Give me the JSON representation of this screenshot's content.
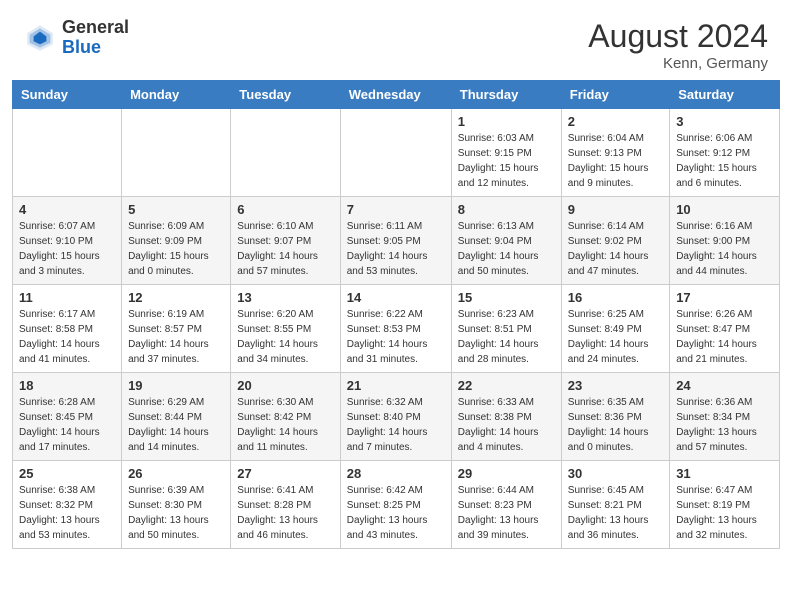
{
  "header": {
    "logo_general": "General",
    "logo_blue": "Blue",
    "month_year": "August 2024",
    "location": "Kenn, Germany"
  },
  "days_of_week": [
    "Sunday",
    "Monday",
    "Tuesday",
    "Wednesday",
    "Thursday",
    "Friday",
    "Saturday"
  ],
  "weeks": [
    [
      {
        "day": "",
        "sunrise": "",
        "sunset": "",
        "daylight": ""
      },
      {
        "day": "",
        "sunrise": "",
        "sunset": "",
        "daylight": ""
      },
      {
        "day": "",
        "sunrise": "",
        "sunset": "",
        "daylight": ""
      },
      {
        "day": "",
        "sunrise": "",
        "sunset": "",
        "daylight": ""
      },
      {
        "day": "1",
        "sunrise": "Sunrise: 6:03 AM",
        "sunset": "Sunset: 9:15 PM",
        "daylight": "Daylight: 15 hours and 12 minutes."
      },
      {
        "day": "2",
        "sunrise": "Sunrise: 6:04 AM",
        "sunset": "Sunset: 9:13 PM",
        "daylight": "Daylight: 15 hours and 9 minutes."
      },
      {
        "day": "3",
        "sunrise": "Sunrise: 6:06 AM",
        "sunset": "Sunset: 9:12 PM",
        "daylight": "Daylight: 15 hours and 6 minutes."
      }
    ],
    [
      {
        "day": "4",
        "sunrise": "Sunrise: 6:07 AM",
        "sunset": "Sunset: 9:10 PM",
        "daylight": "Daylight: 15 hours and 3 minutes."
      },
      {
        "day": "5",
        "sunrise": "Sunrise: 6:09 AM",
        "sunset": "Sunset: 9:09 PM",
        "daylight": "Daylight: 15 hours and 0 minutes."
      },
      {
        "day": "6",
        "sunrise": "Sunrise: 6:10 AM",
        "sunset": "Sunset: 9:07 PM",
        "daylight": "Daylight: 14 hours and 57 minutes."
      },
      {
        "day": "7",
        "sunrise": "Sunrise: 6:11 AM",
        "sunset": "Sunset: 9:05 PM",
        "daylight": "Daylight: 14 hours and 53 minutes."
      },
      {
        "day": "8",
        "sunrise": "Sunrise: 6:13 AM",
        "sunset": "Sunset: 9:04 PM",
        "daylight": "Daylight: 14 hours and 50 minutes."
      },
      {
        "day": "9",
        "sunrise": "Sunrise: 6:14 AM",
        "sunset": "Sunset: 9:02 PM",
        "daylight": "Daylight: 14 hours and 47 minutes."
      },
      {
        "day": "10",
        "sunrise": "Sunrise: 6:16 AM",
        "sunset": "Sunset: 9:00 PM",
        "daylight": "Daylight: 14 hours and 44 minutes."
      }
    ],
    [
      {
        "day": "11",
        "sunrise": "Sunrise: 6:17 AM",
        "sunset": "Sunset: 8:58 PM",
        "daylight": "Daylight: 14 hours and 41 minutes."
      },
      {
        "day": "12",
        "sunrise": "Sunrise: 6:19 AM",
        "sunset": "Sunset: 8:57 PM",
        "daylight": "Daylight: 14 hours and 37 minutes."
      },
      {
        "day": "13",
        "sunrise": "Sunrise: 6:20 AM",
        "sunset": "Sunset: 8:55 PM",
        "daylight": "Daylight: 14 hours and 34 minutes."
      },
      {
        "day": "14",
        "sunrise": "Sunrise: 6:22 AM",
        "sunset": "Sunset: 8:53 PM",
        "daylight": "Daylight: 14 hours and 31 minutes."
      },
      {
        "day": "15",
        "sunrise": "Sunrise: 6:23 AM",
        "sunset": "Sunset: 8:51 PM",
        "daylight": "Daylight: 14 hours and 28 minutes."
      },
      {
        "day": "16",
        "sunrise": "Sunrise: 6:25 AM",
        "sunset": "Sunset: 8:49 PM",
        "daylight": "Daylight: 14 hours and 24 minutes."
      },
      {
        "day": "17",
        "sunrise": "Sunrise: 6:26 AM",
        "sunset": "Sunset: 8:47 PM",
        "daylight": "Daylight: 14 hours and 21 minutes."
      }
    ],
    [
      {
        "day": "18",
        "sunrise": "Sunrise: 6:28 AM",
        "sunset": "Sunset: 8:45 PM",
        "daylight": "Daylight: 14 hours and 17 minutes."
      },
      {
        "day": "19",
        "sunrise": "Sunrise: 6:29 AM",
        "sunset": "Sunset: 8:44 PM",
        "daylight": "Daylight: 14 hours and 14 minutes."
      },
      {
        "day": "20",
        "sunrise": "Sunrise: 6:30 AM",
        "sunset": "Sunset: 8:42 PM",
        "daylight": "Daylight: 14 hours and 11 minutes."
      },
      {
        "day": "21",
        "sunrise": "Sunrise: 6:32 AM",
        "sunset": "Sunset: 8:40 PM",
        "daylight": "Daylight: 14 hours and 7 minutes."
      },
      {
        "day": "22",
        "sunrise": "Sunrise: 6:33 AM",
        "sunset": "Sunset: 8:38 PM",
        "daylight": "Daylight: 14 hours and 4 minutes."
      },
      {
        "day": "23",
        "sunrise": "Sunrise: 6:35 AM",
        "sunset": "Sunset: 8:36 PM",
        "daylight": "Daylight: 14 hours and 0 minutes."
      },
      {
        "day": "24",
        "sunrise": "Sunrise: 6:36 AM",
        "sunset": "Sunset: 8:34 PM",
        "daylight": "Daylight: 13 hours and 57 minutes."
      }
    ],
    [
      {
        "day": "25",
        "sunrise": "Sunrise: 6:38 AM",
        "sunset": "Sunset: 8:32 PM",
        "daylight": "Daylight: 13 hours and 53 minutes."
      },
      {
        "day": "26",
        "sunrise": "Sunrise: 6:39 AM",
        "sunset": "Sunset: 8:30 PM",
        "daylight": "Daylight: 13 hours and 50 minutes."
      },
      {
        "day": "27",
        "sunrise": "Sunrise: 6:41 AM",
        "sunset": "Sunset: 8:28 PM",
        "daylight": "Daylight: 13 hours and 46 minutes."
      },
      {
        "day": "28",
        "sunrise": "Sunrise: 6:42 AM",
        "sunset": "Sunset: 8:25 PM",
        "daylight": "Daylight: 13 hours and 43 minutes."
      },
      {
        "day": "29",
        "sunrise": "Sunrise: 6:44 AM",
        "sunset": "Sunset: 8:23 PM",
        "daylight": "Daylight: 13 hours and 39 minutes."
      },
      {
        "day": "30",
        "sunrise": "Sunrise: 6:45 AM",
        "sunset": "Sunset: 8:21 PM",
        "daylight": "Daylight: 13 hours and 36 minutes."
      },
      {
        "day": "31",
        "sunrise": "Sunrise: 6:47 AM",
        "sunset": "Sunset: 8:19 PM",
        "daylight": "Daylight: 13 hours and 32 minutes."
      }
    ]
  ]
}
